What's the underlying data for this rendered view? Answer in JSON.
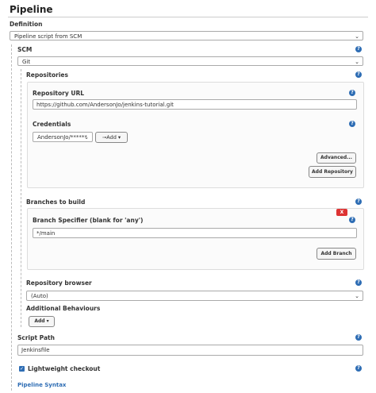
{
  "title": "Pipeline",
  "definition": {
    "label": "Definition",
    "selected": "Pipeline script from SCM"
  },
  "scm": {
    "label": "SCM",
    "selected": "Git"
  },
  "repositories": {
    "label": "Repositories",
    "url_label": "Repository URL",
    "url_value": "https://github.com/AndersonJo/jenkins-tutorial.git",
    "credentials_label": "Credentials",
    "credentials_selected": "AndersonJo/******",
    "add_label": "Add",
    "advanced_label": "Advanced...",
    "add_repository_label": "Add Repository"
  },
  "branches": {
    "label": "Branches to build",
    "delete_label": "X",
    "specifier_label": "Branch Specifier (blank for 'any')",
    "specifier_value": "*/main",
    "add_branch_label": "Add Branch"
  },
  "repository_browser": {
    "label": "Repository browser",
    "selected": "(Auto)"
  },
  "additional_behaviours": {
    "label": "Additional Behaviours",
    "add_label": "Add"
  },
  "script_path": {
    "label": "Script Path",
    "value": "Jenkinsfile"
  },
  "lightweight_checkout": {
    "label": "Lightweight checkout",
    "checked": true
  },
  "pipeline_syntax_label": "Pipeline Syntax",
  "help_glyph": "?",
  "colors": {
    "accent": "#2e6db4",
    "danger": "#dd3333"
  }
}
